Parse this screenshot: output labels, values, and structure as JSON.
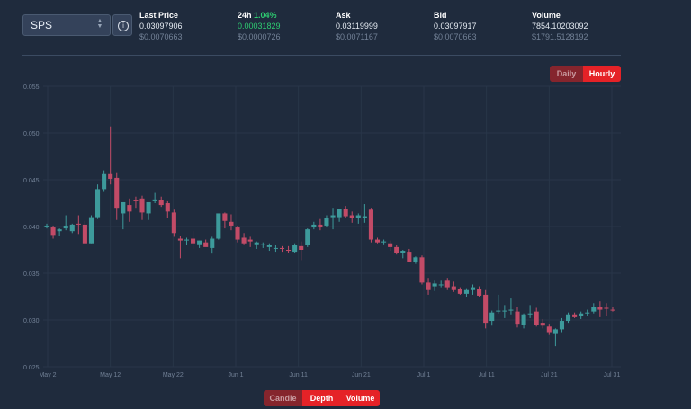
{
  "token_select": {
    "value": "SPS",
    "chevron_icon": "up-down-chevron-icon"
  },
  "info_button": {
    "icon": "info-icon",
    "glyph": "i"
  },
  "stats": {
    "last_price": {
      "label": "Last Price",
      "value": "0.03097906",
      "usd": "$0.0070663"
    },
    "change_24h": {
      "label": "24h",
      "percent": "1.04%",
      "value": "0.00031829",
      "usd": "$0.0000726"
    },
    "ask": {
      "label": "Ask",
      "value": "0.03119999",
      "usd": "$0.0071167"
    },
    "bid": {
      "label": "Bid",
      "value": "0.03097917",
      "usd": "$0.0070663"
    },
    "volume": {
      "label": "Volume",
      "value": "7854.10203092",
      "usd": "$1791.5128192"
    }
  },
  "range_toggle": {
    "daily": "Daily",
    "hourly": "Hourly",
    "active": "Hourly"
  },
  "view_toggle": {
    "candle": "Candle",
    "depth": "Depth",
    "volume": "Volume",
    "active": "Depth"
  },
  "colors": {
    "up": "#3d9a9b",
    "down": "#c24b67",
    "accent": "#e52227",
    "green": "#2ecc71"
  },
  "chart_data": {
    "type": "candlestick",
    "ylim": [
      0.025,
      0.055
    ],
    "y_ticks": [
      "0.025",
      "0.030",
      "0.035",
      "0.040",
      "0.045",
      "0.050",
      "0.055"
    ],
    "x_ticks": [
      "May 2",
      "May 12",
      "May 22",
      "Jun 1",
      "Jun 11",
      "Jun 21",
      "Jul 1",
      "Jul 11",
      "Jul 21",
      "Jul 31"
    ],
    "grid": true,
    "candles": [
      {
        "o": 0.0401,
        "h": 0.0403,
        "l": 0.0398,
        "c": 0.0401
      },
      {
        "o": 0.0399,
        "h": 0.0401,
        "l": 0.0387,
        "c": 0.0391
      },
      {
        "o": 0.0395,
        "h": 0.0398,
        "l": 0.039,
        "c": 0.0397
      },
      {
        "o": 0.0398,
        "h": 0.0412,
        "l": 0.0396,
        "c": 0.0401
      },
      {
        "o": 0.0395,
        "h": 0.0403,
        "l": 0.0393,
        "c": 0.0402
      },
      {
        "o": 0.0403,
        "h": 0.0412,
        "l": 0.0392,
        "c": 0.0402
      },
      {
        "o": 0.0402,
        "h": 0.0406,
        "l": 0.0382,
        "c": 0.0382
      },
      {
        "o": 0.0382,
        "h": 0.0412,
        "l": 0.0382,
        "c": 0.041
      },
      {
        "o": 0.041,
        "h": 0.0445,
        "l": 0.0408,
        "c": 0.044
      },
      {
        "o": 0.044,
        "h": 0.046,
        "l": 0.0437,
        "c": 0.0456
      },
      {
        "o": 0.0456,
        "h": 0.0507,
        "l": 0.0445,
        "c": 0.0451
      },
      {
        "o": 0.0452,
        "h": 0.0458,
        "l": 0.0407,
        "c": 0.042
      },
      {
        "o": 0.0414,
        "h": 0.0425,
        "l": 0.0397,
        "c": 0.0426
      },
      {
        "o": 0.0423,
        "h": 0.043,
        "l": 0.0405,
        "c": 0.0416
      },
      {
        "o": 0.0428,
        "h": 0.0432,
        "l": 0.042,
        "c": 0.0427
      },
      {
        "o": 0.043,
        "h": 0.0433,
        "l": 0.0407,
        "c": 0.0415
      },
      {
        "o": 0.0414,
        "h": 0.0425,
        "l": 0.0407,
        "c": 0.0426
      },
      {
        "o": 0.0427,
        "h": 0.0436,
        "l": 0.0425,
        "c": 0.0429
      },
      {
        "o": 0.0428,
        "h": 0.0432,
        "l": 0.0421,
        "c": 0.0423
      },
      {
        "o": 0.0425,
        "h": 0.0427,
        "l": 0.0409,
        "c": 0.0416
      },
      {
        "o": 0.0415,
        "h": 0.0418,
        "l": 0.0389,
        "c": 0.0393
      },
      {
        "o": 0.0387,
        "h": 0.039,
        "l": 0.0366,
        "c": 0.0385
      },
      {
        "o": 0.0385,
        "h": 0.0388,
        "l": 0.038,
        "c": 0.0386
      },
      {
        "o": 0.0387,
        "h": 0.0395,
        "l": 0.0376,
        "c": 0.0382
      },
      {
        "o": 0.0381,
        "h": 0.0385,
        "l": 0.0377,
        "c": 0.0385
      },
      {
        "o": 0.0383,
        "h": 0.0386,
        "l": 0.0379,
        "c": 0.0378
      },
      {
        "o": 0.0377,
        "h": 0.0389,
        "l": 0.0371,
        "c": 0.0387
      },
      {
        "o": 0.0387,
        "h": 0.0392,
        "l": 0.0386,
        "c": 0.0414
      },
      {
        "o": 0.0414,
        "h": 0.0415,
        "l": 0.0398,
        "c": 0.0406
      },
      {
        "o": 0.0405,
        "h": 0.0413,
        "l": 0.0396,
        "c": 0.0401
      },
      {
        "o": 0.0399,
        "h": 0.0401,
        "l": 0.0383,
        "c": 0.0386
      },
      {
        "o": 0.0388,
        "h": 0.0393,
        "l": 0.0381,
        "c": 0.0382
      },
      {
        "o": 0.0386,
        "h": 0.0389,
        "l": 0.0378,
        "c": 0.0384
      },
      {
        "o": 0.0381,
        "h": 0.0384,
        "l": 0.0376,
        "c": 0.0383
      },
      {
        "o": 0.038,
        "h": 0.0383,
        "l": 0.0377,
        "c": 0.0381
      },
      {
        "o": 0.0378,
        "h": 0.0382,
        "l": 0.0374,
        "c": 0.038
      },
      {
        "o": 0.0377,
        "h": 0.038,
        "l": 0.0373,
        "c": 0.0377
      },
      {
        "o": 0.0377,
        "h": 0.0379,
        "l": 0.0373,
        "c": 0.0376
      },
      {
        "o": 0.0375,
        "h": 0.0379,
        "l": 0.0372,
        "c": 0.0374
      },
      {
        "o": 0.0373,
        "h": 0.0382,
        "l": 0.0372,
        "c": 0.038
      },
      {
        "o": 0.0379,
        "h": 0.0384,
        "l": 0.0364,
        "c": 0.0375
      },
      {
        "o": 0.038,
        "h": 0.0398,
        "l": 0.0378,
        "c": 0.0397
      },
      {
        "o": 0.0399,
        "h": 0.0405,
        "l": 0.0397,
        "c": 0.0402
      },
      {
        "o": 0.0402,
        "h": 0.0408,
        "l": 0.0396,
        "c": 0.0399
      },
      {
        "o": 0.0401,
        "h": 0.0412,
        "l": 0.0399,
        "c": 0.0409
      },
      {
        "o": 0.041,
        "h": 0.042,
        "l": 0.0397,
        "c": 0.0412
      },
      {
        "o": 0.041,
        "h": 0.0416,
        "l": 0.0405,
        "c": 0.0419
      },
      {
        "o": 0.0419,
        "h": 0.0422,
        "l": 0.0409,
        "c": 0.0411
      },
      {
        "o": 0.0412,
        "h": 0.0416,
        "l": 0.0404,
        "c": 0.0409
      },
      {
        "o": 0.0409,
        "h": 0.0414,
        "l": 0.0403,
        "c": 0.0412
      },
      {
        "o": 0.0409,
        "h": 0.0424,
        "l": 0.0404,
        "c": 0.0411
      },
      {
        "o": 0.0418,
        "h": 0.042,
        "l": 0.0383,
        "c": 0.0386
      },
      {
        "o": 0.0386,
        "h": 0.0388,
        "l": 0.0382,
        "c": 0.0383
      },
      {
        "o": 0.0383,
        "h": 0.0386,
        "l": 0.0381,
        "c": 0.0384
      },
      {
        "o": 0.0382,
        "h": 0.0385,
        "l": 0.0374,
        "c": 0.0378
      },
      {
        "o": 0.0378,
        "h": 0.038,
        "l": 0.037,
        "c": 0.0372
      },
      {
        "o": 0.0372,
        "h": 0.0375,
        "l": 0.0366,
        "c": 0.0374
      },
      {
        "o": 0.0373,
        "h": 0.0376,
        "l": 0.0362,
        "c": 0.0362
      },
      {
        "o": 0.0362,
        "h": 0.0368,
        "l": 0.036,
        "c": 0.0367
      },
      {
        "o": 0.0367,
        "h": 0.0369,
        "l": 0.0338,
        "c": 0.034
      },
      {
        "o": 0.034,
        "h": 0.0345,
        "l": 0.0327,
        "c": 0.0332
      },
      {
        "o": 0.0336,
        "h": 0.0342,
        "l": 0.0331,
        "c": 0.0339
      },
      {
        "o": 0.0338,
        "h": 0.0342,
        "l": 0.0335,
        "c": 0.0338
      },
      {
        "o": 0.0342,
        "h": 0.0345,
        "l": 0.0332,
        "c": 0.0335
      },
      {
        "o": 0.0336,
        "h": 0.0341,
        "l": 0.033,
        "c": 0.0332
      },
      {
        "o": 0.0333,
        "h": 0.0335,
        "l": 0.0327,
        "c": 0.0328
      },
      {
        "o": 0.0328,
        "h": 0.0334,
        "l": 0.0325,
        "c": 0.0332
      },
      {
        "o": 0.0332,
        "h": 0.0338,
        "l": 0.0327,
        "c": 0.0335
      },
      {
        "o": 0.0333,
        "h": 0.0336,
        "l": 0.0325,
        "c": 0.0326
      },
      {
        "o": 0.0327,
        "h": 0.0332,
        "l": 0.0291,
        "c": 0.0297
      },
      {
        "o": 0.0299,
        "h": 0.031,
        "l": 0.0294,
        "c": 0.0308
      },
      {
        "o": 0.0309,
        "h": 0.0327,
        "l": 0.0307,
        "c": 0.031
      },
      {
        "o": 0.031,
        "h": 0.0316,
        "l": 0.0302,
        "c": 0.031
      },
      {
        "o": 0.031,
        "h": 0.0323,
        "l": 0.0306,
        "c": 0.0311
      },
      {
        "o": 0.0309,
        "h": 0.0314,
        "l": 0.0292,
        "c": 0.0296
      },
      {
        "o": 0.0295,
        "h": 0.0307,
        "l": 0.0291,
        "c": 0.0306
      },
      {
        "o": 0.0306,
        "h": 0.0316,
        "l": 0.0302,
        "c": 0.0307
      },
      {
        "o": 0.0309,
        "h": 0.0313,
        "l": 0.0293,
        "c": 0.0295
      },
      {
        "o": 0.0297,
        "h": 0.0301,
        "l": 0.0291,
        "c": 0.0294
      },
      {
        "o": 0.0293,
        "h": 0.0296,
        "l": 0.0284,
        "c": 0.0287
      },
      {
        "o": 0.0285,
        "h": 0.0291,
        "l": 0.0272,
        "c": 0.029
      },
      {
        "o": 0.029,
        "h": 0.0302,
        "l": 0.0287,
        "c": 0.0299
      },
      {
        "o": 0.0299,
        "h": 0.0308,
        "l": 0.0297,
        "c": 0.0306
      },
      {
        "o": 0.0306,
        "h": 0.0308,
        "l": 0.0302,
        "c": 0.0303
      },
      {
        "o": 0.0304,
        "h": 0.0309,
        "l": 0.0301,
        "c": 0.0307
      },
      {
        "o": 0.0307,
        "h": 0.0311,
        "l": 0.0304,
        "c": 0.0308
      },
      {
        "o": 0.0309,
        "h": 0.0318,
        "l": 0.0307,
        "c": 0.0314
      },
      {
        "o": 0.0314,
        "h": 0.032,
        "l": 0.0303,
        "c": 0.0311
      },
      {
        "o": 0.0313,
        "h": 0.0318,
        "l": 0.0304,
        "c": 0.0312
      },
      {
        "o": 0.0311,
        "h": 0.0314,
        "l": 0.0309,
        "c": 0.031
      }
    ]
  }
}
